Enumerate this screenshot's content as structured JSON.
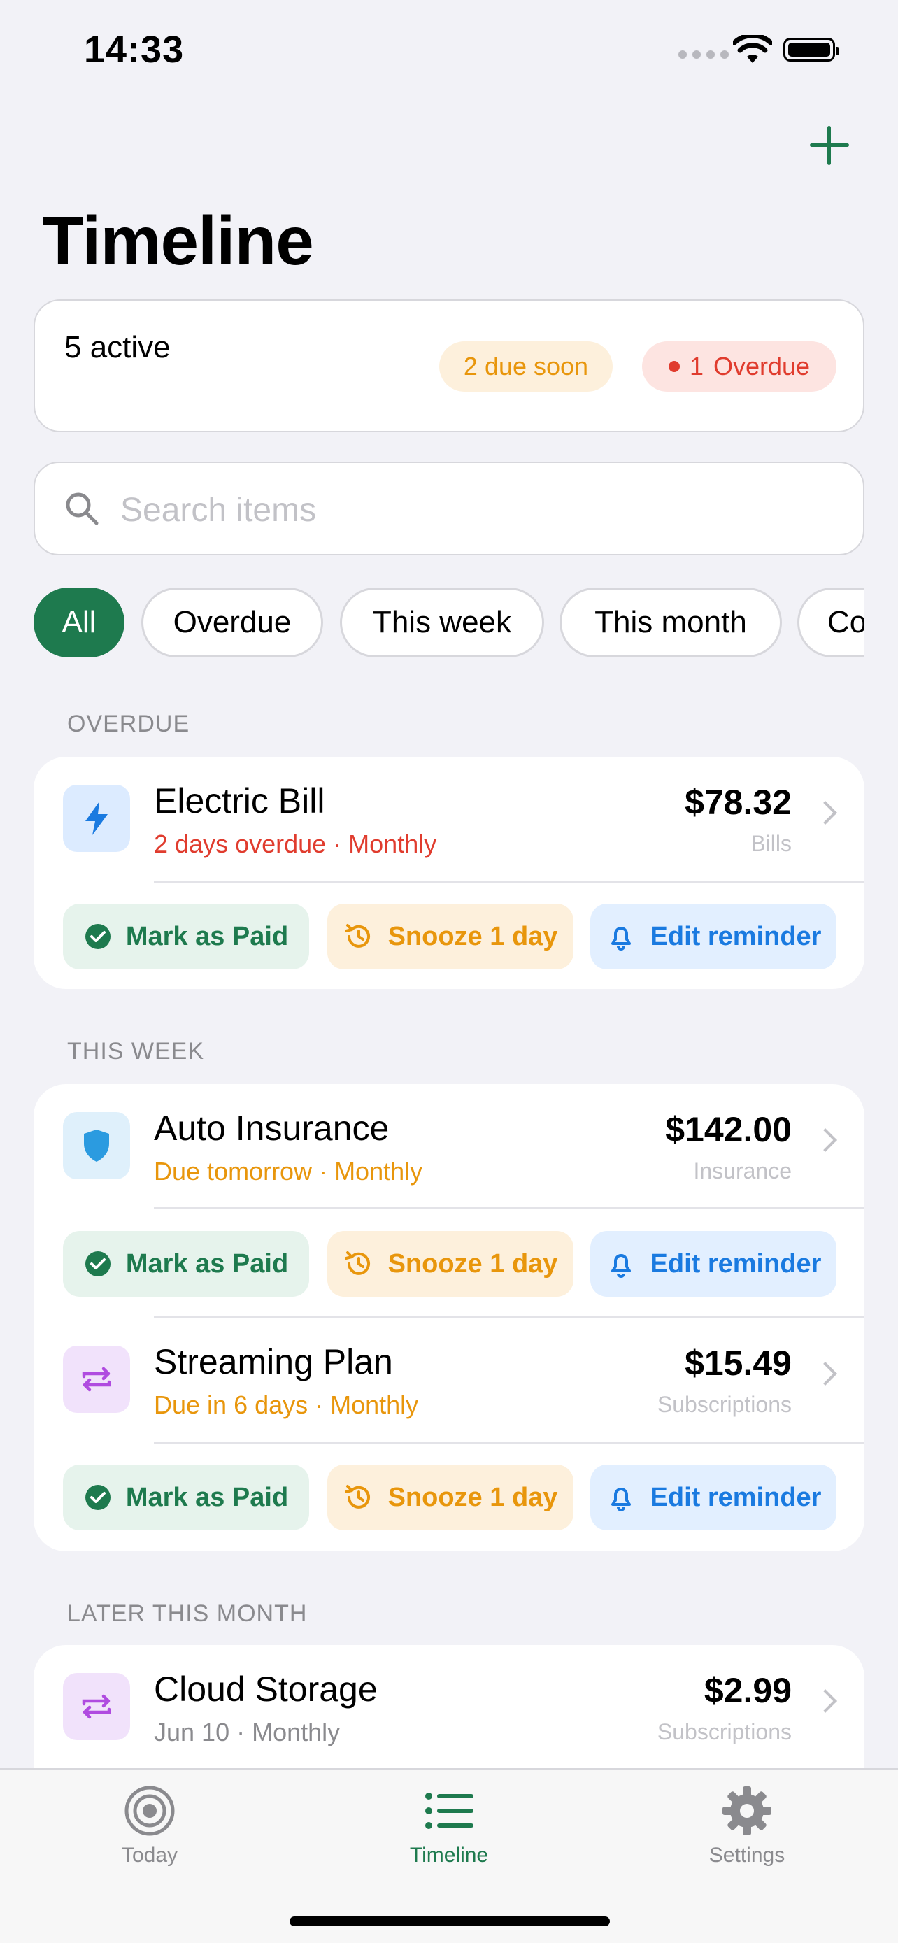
{
  "status_bar": {
    "time": "14:33"
  },
  "header": {
    "title": "Timeline"
  },
  "summary": {
    "active": "5 active",
    "due_soon": "2 due soon",
    "overdue_count": "1",
    "overdue_label": "Overdue"
  },
  "search": {
    "placeholder": "Search items"
  },
  "filters": [
    "All",
    "Overdue",
    "This week",
    "This month",
    "Co"
  ],
  "actions": {
    "paid": "Mark as Paid",
    "snooze": "Snooze 1 day",
    "edit": "Edit reminder"
  },
  "sections": {
    "overdue": {
      "label": "OVERDUE",
      "items": [
        {
          "name": "Electric Bill",
          "sub": "2 days overdue · Monthly",
          "amount": "$78.32",
          "category": "Bills",
          "icon": "lightning-icon",
          "status_color": "#e03c2e"
        }
      ]
    },
    "this_week": {
      "label": "THIS WEEK",
      "items": [
        {
          "name": "Auto Insurance",
          "sub": "Due tomorrow · Monthly",
          "amount": "$142.00",
          "category": "Insurance",
          "icon": "shield-icon",
          "status_color": "#e8960c"
        },
        {
          "name": "Streaming Plan",
          "sub": "Due in 6 days · Monthly",
          "amount": "$15.49",
          "category": "Subscriptions",
          "icon": "repeat-icon",
          "status_color": "#e8960c"
        }
      ]
    },
    "later": {
      "label": "LATER THIS MONTH",
      "items": [
        {
          "name": "Cloud Storage",
          "sub": "Jun 10 · Monthly",
          "amount": "$2.99",
          "category": "Subscriptions",
          "icon": "repeat-icon",
          "status_color": "#8a8a8e"
        }
      ]
    }
  },
  "tabbar": {
    "today": "Today",
    "timeline": "Timeline",
    "settings": "Settings"
  },
  "colors": {
    "accent": "#1e7a4e",
    "warning": "#e8960c",
    "danger": "#e03c2e",
    "link": "#1a7ae0"
  }
}
